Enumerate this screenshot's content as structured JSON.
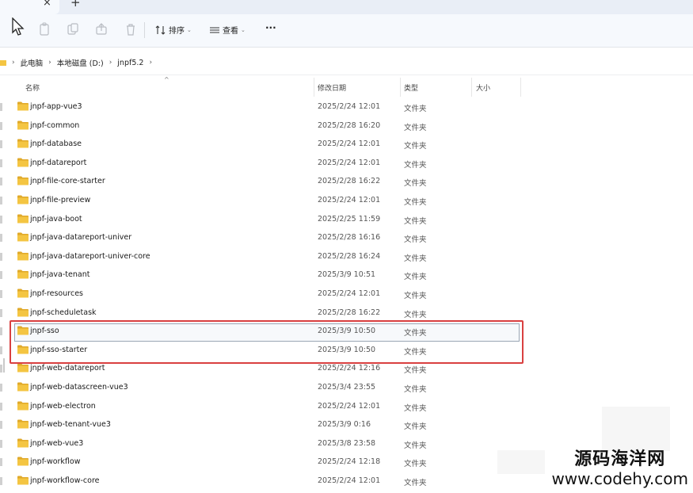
{
  "tabbar": {
    "close_glyph": "×",
    "new_glyph": "+"
  },
  "toolbar": {
    "sort_label": "排序",
    "view_label": "查看",
    "more_label": "···",
    "icons": [
      "cursor-icon",
      "copy-icon",
      "paste-icon",
      "share-icon",
      "delete-icon",
      "sort-icon",
      "view-icon"
    ]
  },
  "breadcrumb": {
    "items": [
      "此电脑",
      "本地磁盘 (D:)",
      "jnpf5.2"
    ],
    "sep": "›"
  },
  "header": {
    "name": "名称",
    "modified": "修改日期",
    "type": "类型",
    "size": "大小",
    "sort_caret": "^"
  },
  "rows": [
    {
      "name": "jnpf-app-vue3",
      "date": "2025/2/24 12:01",
      "type": "文件夹"
    },
    {
      "name": "jnpf-common",
      "date": "2025/2/28 16:20",
      "type": "文件夹"
    },
    {
      "name": "jnpf-database",
      "date": "2025/2/24 12:01",
      "type": "文件夹"
    },
    {
      "name": "jnpf-datareport",
      "date": "2025/2/24 12:01",
      "type": "文件夹"
    },
    {
      "name": "jnpf-file-core-starter",
      "date": "2025/2/28 16:22",
      "type": "文件夹"
    },
    {
      "name": "jnpf-file-preview",
      "date": "2025/2/24 12:01",
      "type": "文件夹"
    },
    {
      "name": "jnpf-java-boot",
      "date": "2025/2/25 11:59",
      "type": "文件夹"
    },
    {
      "name": "jnpf-java-datareport-univer",
      "date": "2025/2/28 16:16",
      "type": "文件夹"
    },
    {
      "name": "jnpf-java-datareport-univer-core",
      "date": "2025/2/28 16:24",
      "type": "文件夹"
    },
    {
      "name": "jnpf-java-tenant",
      "date": "2025/3/9 10:51",
      "type": "文件夹"
    },
    {
      "name": "jnpf-resources",
      "date": "2025/2/24 12:01",
      "type": "文件夹"
    },
    {
      "name": "jnpf-scheduletask",
      "date": "2025/2/28 16:22",
      "type": "文件夹"
    },
    {
      "name": "jnpf-sso",
      "date": "2025/3/9 10:50",
      "type": "文件夹"
    },
    {
      "name": "jnpf-sso-starter",
      "date": "2025/3/9 10:50",
      "type": "文件夹"
    },
    {
      "name": "jnpf-web-datareport",
      "date": "2025/2/24 12:16",
      "type": "文件夹"
    },
    {
      "name": "jnpf-web-datascreen-vue3",
      "date": "2025/3/4 23:55",
      "type": "文件夹"
    },
    {
      "name": "jnpf-web-electron",
      "date": "2025/2/24 12:01",
      "type": "文件夹"
    },
    {
      "name": "jnpf-web-tenant-vue3",
      "date": "2025/3/9 0:16",
      "type": "文件夹"
    },
    {
      "name": "jnpf-web-vue3",
      "date": "2025/3/8 23:58",
      "type": "文件夹"
    },
    {
      "name": "jnpf-workflow",
      "date": "2025/2/24 12:18",
      "type": "文件夹"
    },
    {
      "name": "jnpf-workflow-core",
      "date": "2025/2/24 12:01",
      "type": "文件夹"
    }
  ],
  "watermark": {
    "cn": "源码海洋网",
    "en": "www.codehy.com"
  },
  "colors": {
    "highlight": "#d94040",
    "folder": "#f4c542",
    "folder_dark": "#e0a92a"
  }
}
